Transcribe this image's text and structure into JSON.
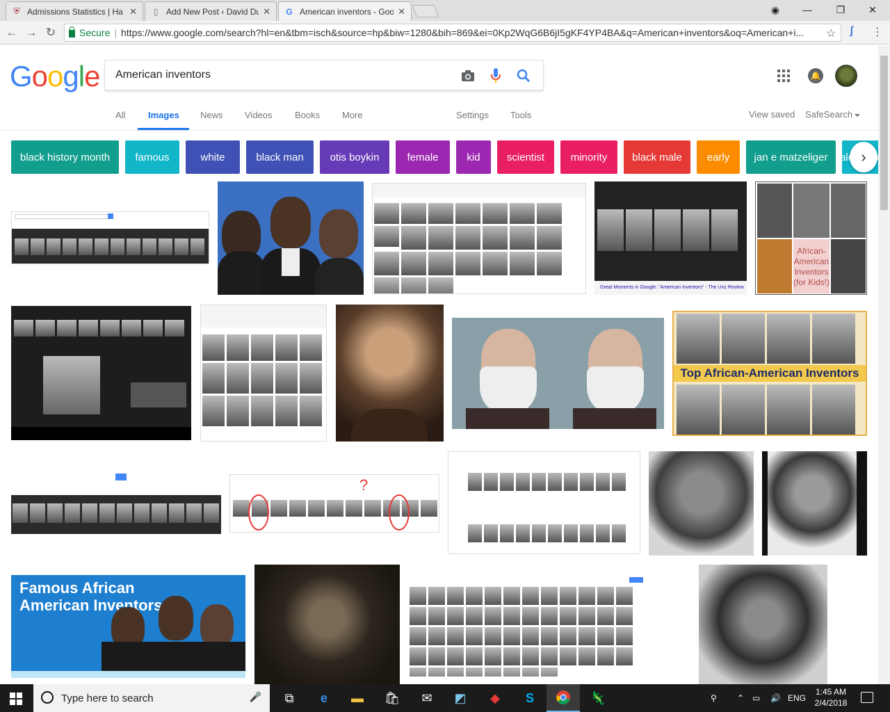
{
  "browser": {
    "tabs": [
      {
        "title": "Admissions Statistics | Ha",
        "favicon": "harvard-shield-icon"
      },
      {
        "title": "Add New Post ‹ David Du",
        "favicon": "wordpress-page-icon"
      },
      {
        "title": "American inventors - Goo",
        "favicon": "google-g-icon",
        "active": true
      }
    ],
    "secure_label": "Secure",
    "url": "https://www.google.com/search?hl=en&tbm=isch&source=hp&biw=1280&bih=869&ei=0Kp2WqG6B6jI5gKF4YP4BA&q=American+inventors&oq=American+i..."
  },
  "google": {
    "logo": [
      "G",
      "o",
      "o",
      "g",
      "l",
      "e"
    ],
    "logo_colors": [
      "#4285F4",
      "#EA4335",
      "#FBBC05",
      "#4285F4",
      "#34A853",
      "#EA4335"
    ],
    "query": "American inventors",
    "tabs": {
      "all": "All",
      "images": "Images",
      "news": "News",
      "videos": "Videos",
      "books": "Books",
      "more": "More",
      "settings": "Settings",
      "tools": "Tools",
      "view_saved": "View saved",
      "safesearch": "SafeSearch"
    },
    "chips": [
      {
        "label": "black history month",
        "color": "#119e8d"
      },
      {
        "label": "famous",
        "color": "#11b6c9"
      },
      {
        "label": "white",
        "color": "#3f51b5"
      },
      {
        "label": "black man",
        "color": "#3f51b5"
      },
      {
        "label": "otis boykin",
        "color": "#673ab7"
      },
      {
        "label": "female",
        "color": "#9c27b0"
      },
      {
        "label": "kid",
        "color": "#9c27b0"
      },
      {
        "label": "scientist",
        "color": "#e91e63"
      },
      {
        "label": "minority",
        "color": "#e91e63"
      },
      {
        "label": "black male",
        "color": "#e53935"
      },
      {
        "label": "early",
        "color": "#fb8c00"
      },
      {
        "label": "jan e matzeliger",
        "color": "#119e8d"
      },
      {
        "label": "alexander",
        "color": "#11b6c9"
      }
    ],
    "image_text": {
      "african_american_kids": "African-American Inventors (for Kids!)",
      "top_aa": "Top African-American Inventors",
      "famous_aa": "Famous African American Inventors",
      "unz_caption": "Great Moments in Google: \"American Inventors\" - The Unz Review"
    }
  },
  "taskbar": {
    "search_placeholder": "Type here to search",
    "language": "ENG",
    "time": "1:45 AM",
    "date": "2/4/2018"
  }
}
